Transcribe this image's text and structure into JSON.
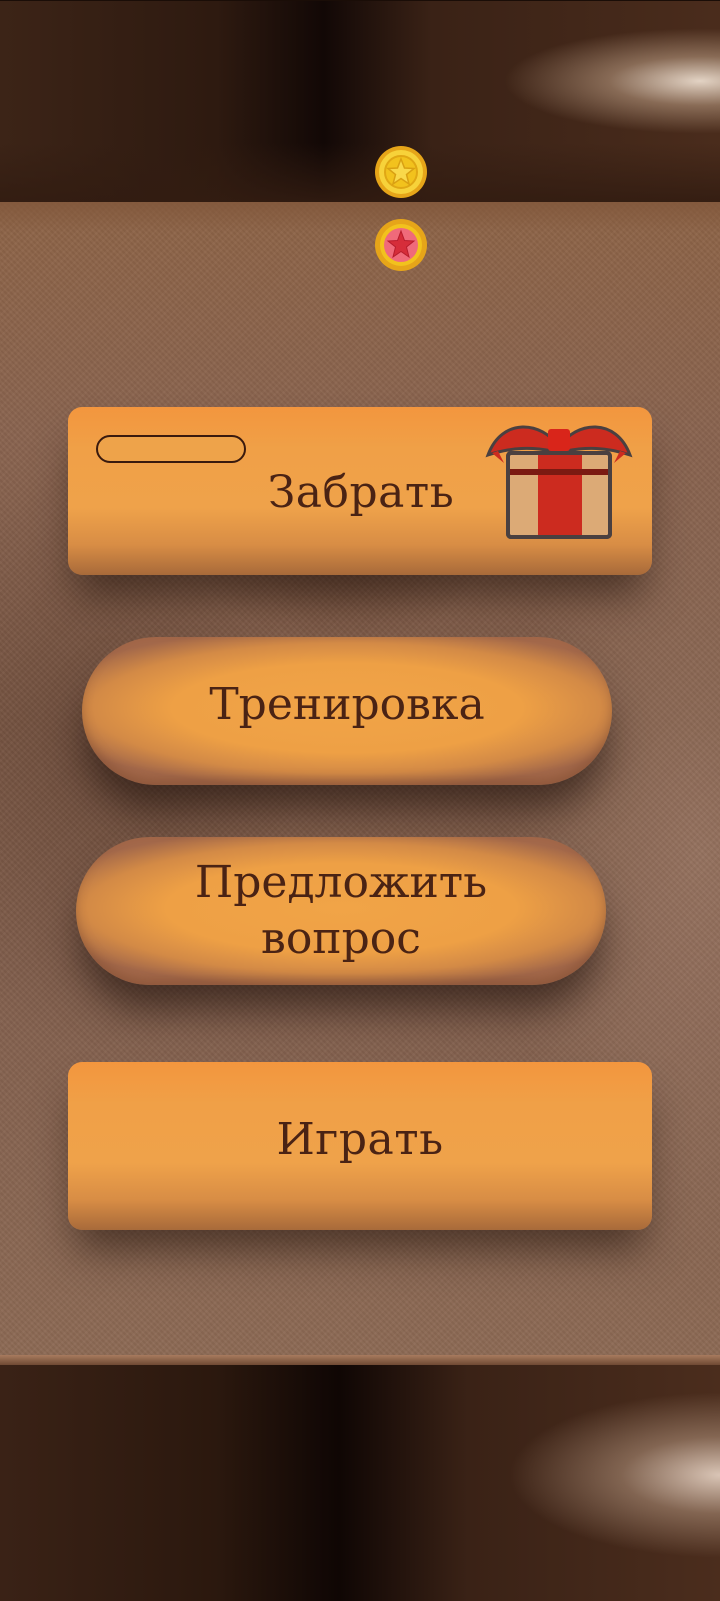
{
  "header": {
    "coins": [
      {
        "icon": "gold-star-coin-icon",
        "color": "#f2c21d"
      },
      {
        "icon": "red-star-coin-icon",
        "color": "#e04040"
      }
    ]
  },
  "menu": {
    "claim": {
      "label": "Забрать",
      "progress": 0,
      "icon": "gift-box-icon"
    },
    "training": {
      "label": "Тренировка"
    },
    "suggest": {
      "label_line1": "Предложить",
      "label_line2": "вопрос"
    },
    "play": {
      "label": "Играть"
    }
  },
  "colors": {
    "button_orange": "#f0a047",
    "button_text": "#4a2314",
    "background_brown": "#8a6450"
  }
}
